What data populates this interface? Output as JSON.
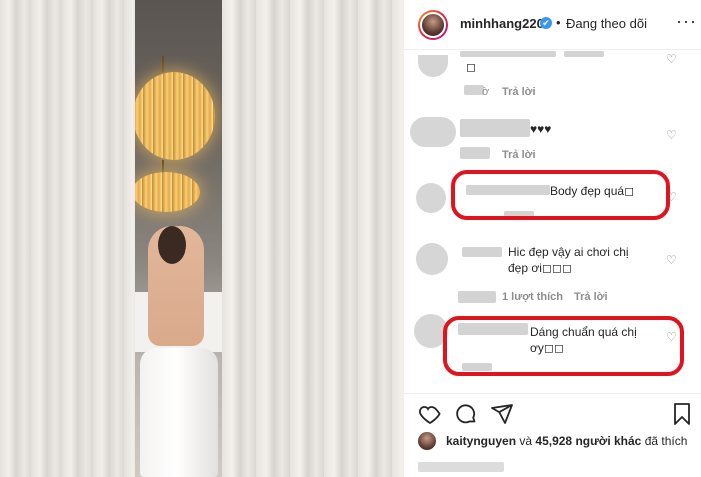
{
  "header": {
    "username": "minhhang2206",
    "verified_icon": "✔",
    "separator": "•",
    "follow_label": "Đang theo dõi",
    "more_label": "···"
  },
  "comments": [
    {
      "text": "",
      "reply_label": "Trả lời",
      "time_fragment": "ờ",
      "emoji": "◻"
    },
    {
      "text": "♥♥♥",
      "reply_label": "Trả lời"
    },
    {
      "text": "Body đẹp quá◻",
      "suffix_prefix": "♥"
    },
    {
      "text": "Hic đẹp vậy ai chơi chị đẹp ơi◻◻◻",
      "likes_label": "1 lượt thích",
      "reply_label": "Trả lời"
    },
    {
      "text": "Dáng chuẩn quá chị ơy◻◻"
    }
  ],
  "likes": {
    "first_user": "kaitynguyen",
    "connector": "và",
    "others": "45,928 người khác",
    "liked_label": "đã thích"
  },
  "colors": {
    "highlight": "#e0141e",
    "verified": "#3897f0",
    "text": "#262626",
    "muted": "#8e8e8e"
  }
}
